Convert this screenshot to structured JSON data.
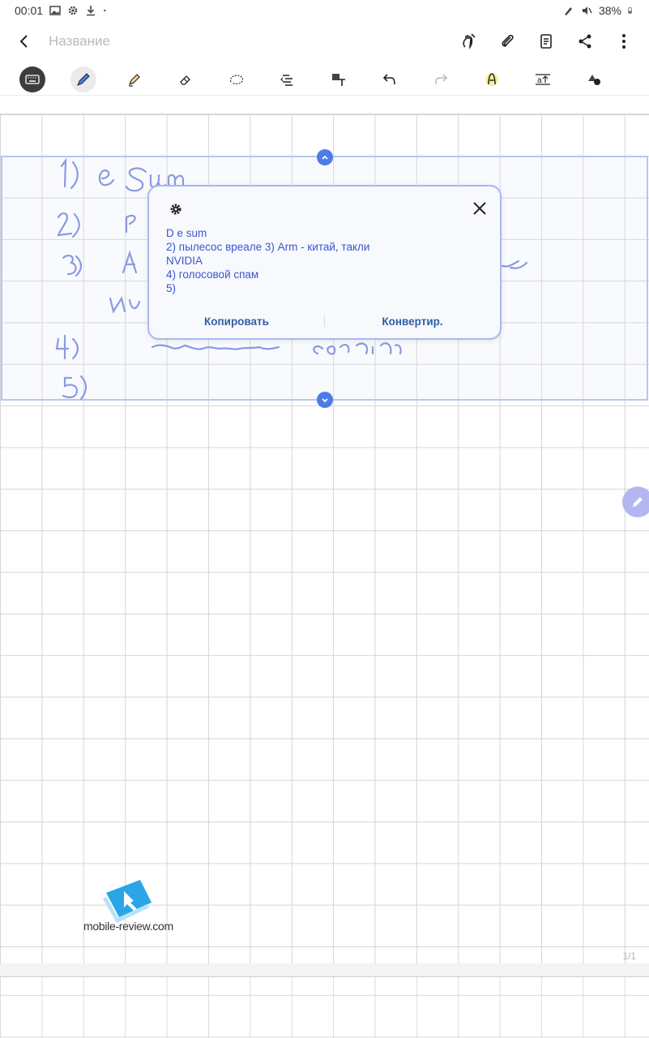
{
  "status_bar": {
    "time": "00:01",
    "battery": "38%"
  },
  "app_bar": {
    "title_placeholder": "Название"
  },
  "popup": {
    "recognized_lines": [
      "D e sum",
      "2) пылесос вреале 3) Arm - китай, такли",
      "NVIDIA",
      "4) голосовой спам",
      "5)"
    ],
    "copy_label": "Копировать",
    "convert_label": "Конвертир."
  },
  "page_indicator": "1/1",
  "watermark": {
    "text": "mobile-review.com"
  },
  "colors": {
    "accent": "#4f7be6",
    "popup_text": "#3a55d0",
    "ink": "#8a9be0"
  }
}
